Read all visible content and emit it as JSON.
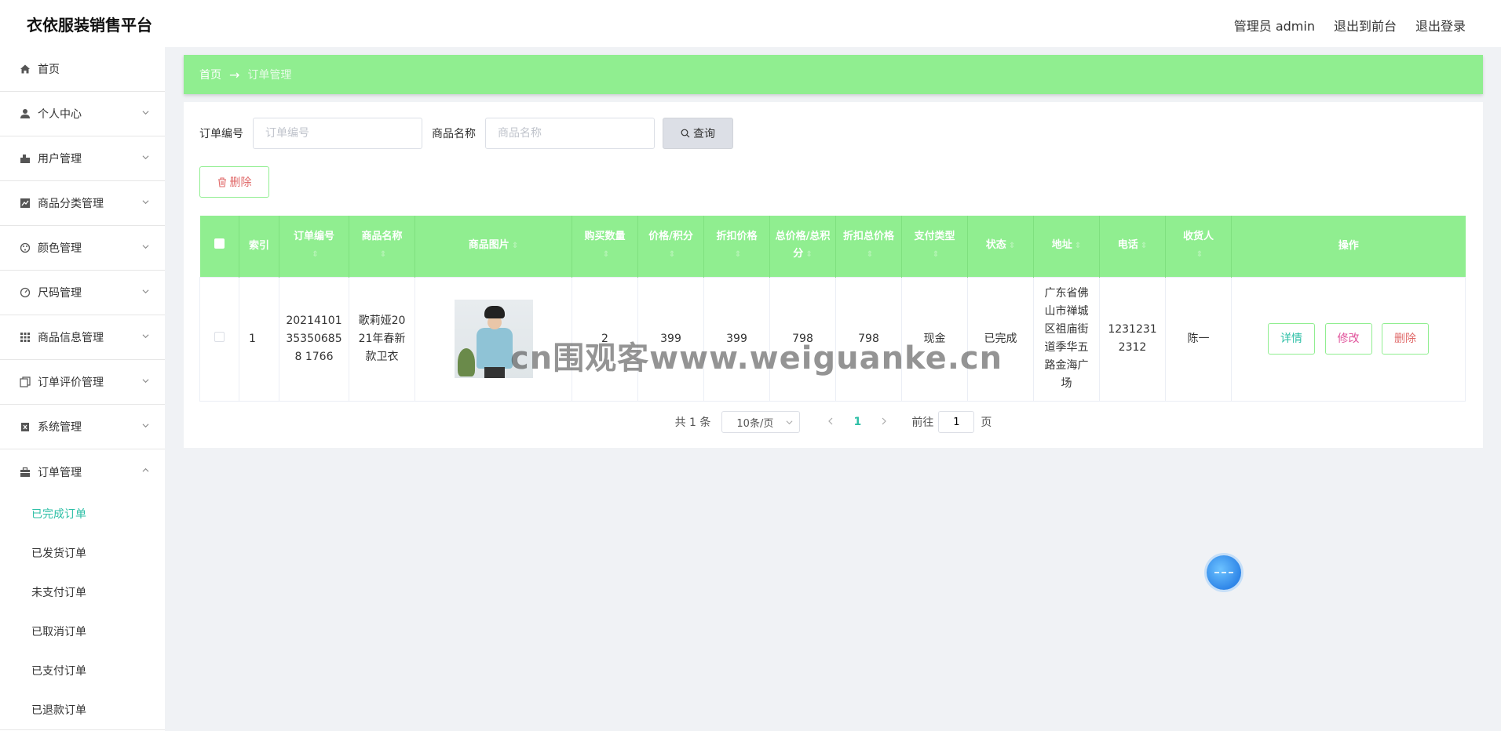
{
  "header": {
    "app_title": "衣依服装销售平台",
    "user_label": "管理员 admin",
    "to_frontend": "退出到前台",
    "logout": "退出登录"
  },
  "sidebar": {
    "items": [
      {
        "label": "首页",
        "icon": "home-icon"
      },
      {
        "label": "个人中心",
        "icon": "user-icon"
      },
      {
        "label": "用户管理",
        "icon": "users-icon"
      },
      {
        "label": "商品分类管理",
        "icon": "chart-icon"
      },
      {
        "label": "颜色管理",
        "icon": "palette-icon"
      },
      {
        "label": "尺码管理",
        "icon": "gauge-icon"
      },
      {
        "label": "商品信息管理",
        "icon": "grid-icon"
      },
      {
        "label": "订单评价管理",
        "icon": "copy-icon"
      },
      {
        "label": "系统管理",
        "icon": "clipboard-icon"
      },
      {
        "label": "订单管理",
        "icon": "briefcase-icon"
      }
    ],
    "order_sub": [
      {
        "label": "已完成订单",
        "active": true
      },
      {
        "label": "已发货订单"
      },
      {
        "label": "未支付订单"
      },
      {
        "label": "已取消订单"
      },
      {
        "label": "已支付订单"
      },
      {
        "label": "已退款订单"
      }
    ]
  },
  "breadcrumb": {
    "home": "首页",
    "separator": "→",
    "current": "订单管理"
  },
  "search": {
    "order_no_label": "订单编号",
    "order_no_placeholder": "订单编号",
    "product_label": "商品名称",
    "product_placeholder": "商品名称",
    "query_button": "查询"
  },
  "toolbar": {
    "delete_button": "删除"
  },
  "table": {
    "headers": [
      "索引",
      "订单编号",
      "商品名称",
      "商品图片",
      "购买数量",
      "价格/积分",
      "折扣价格",
      "总价格/总积分",
      "折扣总价格",
      "支付类型",
      "状态",
      "地址",
      "电话",
      "收货人",
      "操作"
    ],
    "rows": [
      {
        "index": "1",
        "order_no": "20214101353506858 1766",
        "product": "歌莉娅2021年春新款卫衣",
        "qty": "2",
        "price": "399",
        "discount_price": "399",
        "total": "798",
        "discount_total": "798",
        "pay_type": "现金",
        "status": "已完成",
        "address": "广东省佛山市禅城区祖庙街道季华五路金海广场",
        "phone": "12312312312",
        "receiver": "陈一"
      }
    ],
    "actions": {
      "detail": "详情",
      "edit": "修改",
      "delete": "删除"
    }
  },
  "pagination": {
    "total": "共 1 条",
    "page_size": "10条/页",
    "current_page": "1",
    "goto_label": "前往",
    "goto_value": "1",
    "page_suffix": "页"
  },
  "watermark": "cn围观客www.weiguanke.cn"
}
